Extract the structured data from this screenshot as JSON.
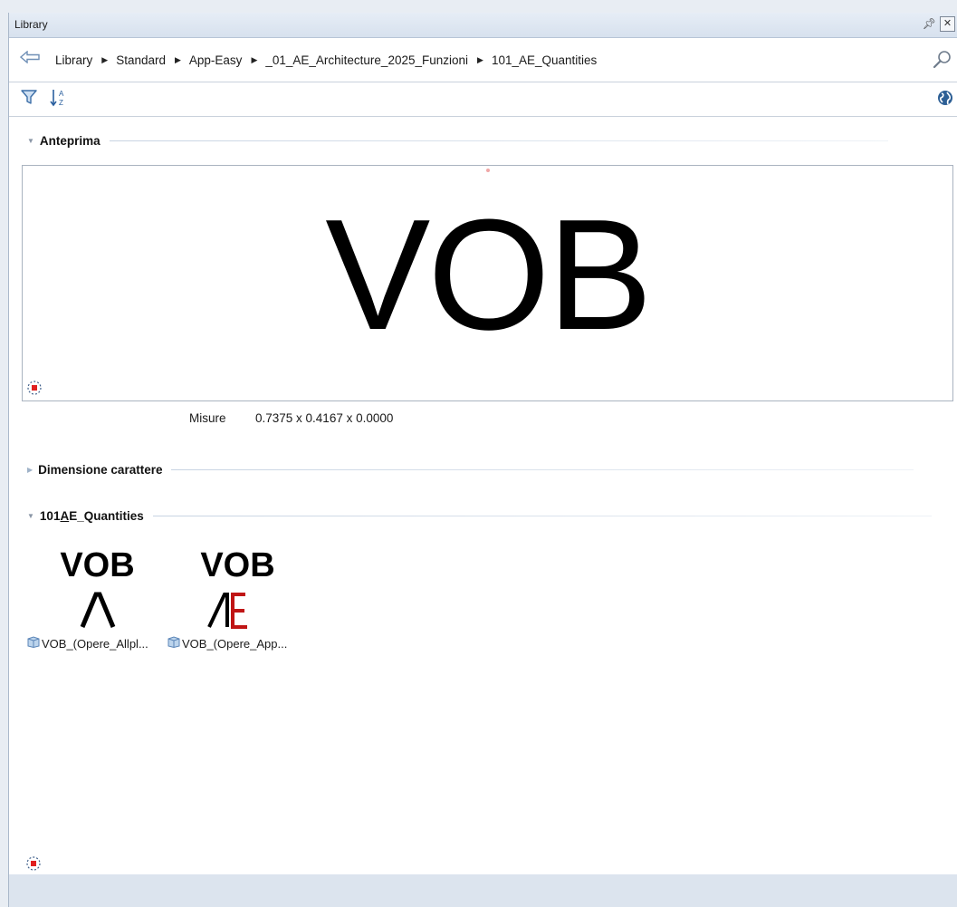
{
  "window": {
    "title": "Library"
  },
  "breadcrumb": {
    "items": [
      "Library",
      "Standard",
      "App-Easy",
      "_01_AE_Architecture_2025_Funzioni",
      "101_AE_Quantities"
    ]
  },
  "sections": {
    "preview": {
      "label": "Anteprima",
      "text": "VOB",
      "measure_label": "Misure",
      "measure_value": "0.7375 x 0.4167 x 0.0000"
    },
    "font_size": {
      "label": "Dimensione carattere"
    },
    "folder": {
      "label_prefix": "101",
      "label_underlined": "A",
      "label_suffix": "E_Quantities",
      "items": [
        {
          "title": "VOB",
          "name": "VOB_(Opere_Allpl..."
        },
        {
          "title": "VOB",
          "name": "VOB_(Opere_App..."
        }
      ]
    }
  },
  "colors": {
    "accent_red": "#c01515",
    "icon_blue": "#2a5f9e"
  },
  "icons": [
    "back-arrow-icon",
    "breadcrumb-separator-icon",
    "search-icon",
    "filter-icon",
    "sort-az-icon",
    "globe-icon",
    "pin-icon",
    "close-icon",
    "cube-icon",
    "marker-icon"
  ]
}
